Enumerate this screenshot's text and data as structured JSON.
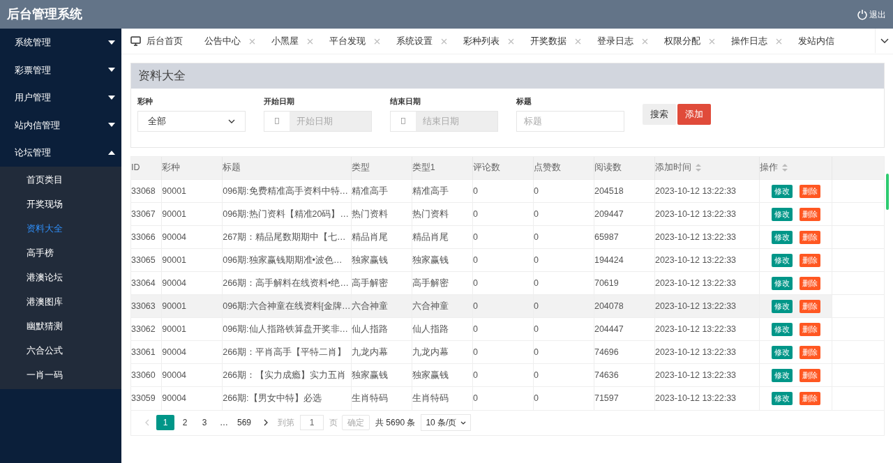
{
  "header": {
    "title": "后台管理系统",
    "logout": "退出"
  },
  "sidebar": {
    "items": [
      {
        "label": "系统管理",
        "expanded": false
      },
      {
        "label": "彩票管理",
        "expanded": false
      },
      {
        "label": "用户管理",
        "expanded": false
      },
      {
        "label": "站内信管理",
        "expanded": false
      },
      {
        "label": "论坛管理",
        "expanded": true,
        "children": [
          {
            "label": "首页类目",
            "selected": false
          },
          {
            "label": "开奖现场",
            "selected": false
          },
          {
            "label": "资料大全",
            "selected": true
          },
          {
            "label": "高手榜",
            "selected": false
          },
          {
            "label": "港澳论坛",
            "selected": false
          },
          {
            "label": "港澳图库",
            "selected": false
          },
          {
            "label": "幽默猜测",
            "selected": false
          },
          {
            "label": "六合公式",
            "selected": false
          },
          {
            "label": "一肖一码",
            "selected": false
          }
        ]
      }
    ]
  },
  "tabs": [
    {
      "label": "后台首页",
      "kind": "home"
    },
    {
      "label": "公告中心",
      "kind": "closable"
    },
    {
      "label": "小黑屋",
      "kind": "closable"
    },
    {
      "label": "平台发现",
      "kind": "closable"
    },
    {
      "label": "系统设置",
      "kind": "closable"
    },
    {
      "label": "彩种列表",
      "kind": "closable"
    },
    {
      "label": "开奖数据",
      "kind": "closable"
    },
    {
      "label": "登录日志",
      "kind": "closable"
    },
    {
      "label": "权限分配",
      "kind": "closable"
    },
    {
      "label": "操作日志",
      "kind": "closable"
    },
    {
      "label": "发站内信",
      "kind": "plain"
    }
  ],
  "panel": {
    "title": "资料大全"
  },
  "filters": {
    "lottery": {
      "label": "彩种",
      "value": "全部"
    },
    "start_date": {
      "label": "开始日期",
      "placeholder": "开始日期"
    },
    "end_date": {
      "label": "结束日期",
      "placeholder": "结束日期"
    },
    "title": {
      "label": "标题",
      "placeholder": "标题"
    },
    "search_button": "搜索",
    "add_button": "添加"
  },
  "table": {
    "columns": [
      {
        "label": "ID",
        "sortable": false
      },
      {
        "label": "彩种",
        "sortable": false
      },
      {
        "label": "标题",
        "sortable": false
      },
      {
        "label": "类型",
        "sortable": false
      },
      {
        "label": "类型1",
        "sortable": false
      },
      {
        "label": "评论数",
        "sortable": false
      },
      {
        "label": "点赞数",
        "sortable": false
      },
      {
        "label": "阅读数",
        "sortable": false
      },
      {
        "label": "添加时间",
        "sortable": true
      },
      {
        "label": "操作",
        "sortable": true
      }
    ],
    "rows": [
      {
        "cells": [
          "33068",
          "90001",
          "096期:免费精准高手资料中特…",
          "精准高手",
          "精准高手",
          "0",
          "0",
          "204518",
          "2023-10-12 13:22:33"
        ],
        "actions": [
          "修改",
          "删除"
        ],
        "highlighted": false
      },
      {
        "cells": [
          "33067",
          "90001",
          "096期:热门资料【精准20码】…",
          "热门资料",
          "热门资料",
          "0",
          "0",
          "209447",
          "2023-10-12 13:22:33"
        ],
        "actions": [
          "修改",
          "删除"
        ],
        "highlighted": false
      },
      {
        "cells": [
          "33066",
          "90004",
          "267期：精品尾数期期中【七…",
          "精品肖尾",
          "精品肖尾",
          "0",
          "0",
          "65987",
          "2023-10-12 13:22:33"
        ],
        "actions": [
          "修改",
          "删除"
        ],
        "highlighted": false
      },
      {
        "cells": [
          "33065",
          "90001",
          "096期:独家赢钱期期准•波色…",
          "独家赢钱",
          "独家赢钱",
          "0",
          "0",
          "194424",
          "2023-10-12 13:22:33"
        ],
        "actions": [
          "修改",
          "删除"
        ],
        "highlighted": false
      },
      {
        "cells": [
          "33064",
          "90004",
          "266期：高手解料在线资料•绝…",
          "高手解密",
          "高手解密",
          "0",
          "0",
          "70619",
          "2023-10-12 13:22:33"
        ],
        "actions": [
          "修改",
          "删除"
        ],
        "highlighted": false
      },
      {
        "cells": [
          "33063",
          "90001",
          "096期:六合神童在线资料[金牌…",
          "六合神童",
          "六合神童",
          "0",
          "0",
          "204078",
          "2023-10-12 13:22:33"
        ],
        "actions": [
          "修改",
          "删除"
        ],
        "highlighted": true
      },
      {
        "cells": [
          "33062",
          "90001",
          "096期:仙人指路铁算盘开奖非…",
          "仙人指路",
          "仙人指路",
          "0",
          "0",
          "204447",
          "2023-10-12 13:22:33"
        ],
        "actions": [
          "修改",
          "删除"
        ],
        "highlighted": false
      },
      {
        "cells": [
          "33061",
          "90004",
          "266期：平肖高手【平特二肖】",
          "九龙内幕",
          "九龙内幕",
          "0",
          "0",
          "74696",
          "2023-10-12 13:22:33"
        ],
        "actions": [
          "修改",
          "删除"
        ],
        "highlighted": false
      },
      {
        "cells": [
          "33060",
          "90004",
          "266期：【实力成瘾】实力五肖",
          "独家赢钱",
          "独家赢钱",
          "0",
          "0",
          "74636",
          "2023-10-12 13:22:33"
        ],
        "actions": [
          "修改",
          "删除"
        ],
        "highlighted": false
      },
      {
        "cells": [
          "33059",
          "90004",
          "266期:【男女中特】必选",
          "生肖特码",
          "生肖特码",
          "0",
          "0",
          "71597",
          "2023-10-12 13:22:33"
        ],
        "actions": [
          "修改",
          "删除"
        ],
        "highlighted": false
      }
    ]
  },
  "pagination": {
    "pages": [
      {
        "label": "1",
        "selected": true
      },
      {
        "label": "2",
        "selected": false
      },
      {
        "label": "3",
        "selected": false
      },
      {
        "label": "…",
        "selected": false
      },
      {
        "label": "569",
        "selected": false
      }
    ],
    "goto_label": "到第",
    "goto_value": "1",
    "page_unit": "页",
    "confirm": "确定",
    "total": "共 5690 条",
    "page_size": "10 条/页"
  }
}
